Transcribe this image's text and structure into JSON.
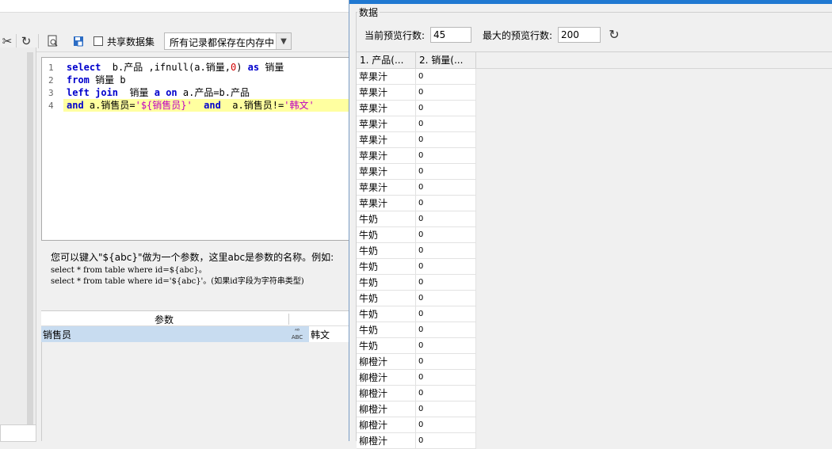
{
  "toolbar": {
    "share_label": "共享数据集",
    "memory_mode": "所有记录都保存在内存中"
  },
  "editor": {
    "line_numbers": [
      "1",
      "2",
      "3",
      "4"
    ],
    "line1": {
      "kw1": "select",
      "t1": "  b.产品 ,ifnull(a.销量,",
      "num": "0",
      "t2": ") ",
      "kw2": "as",
      "t3": " 销量"
    },
    "line2": {
      "kw1": "from",
      "t1": " 销量 b"
    },
    "line3": {
      "kw1": "left join",
      "t1": "  销量 ",
      "kw2": "a",
      "t2": " ",
      "kw3": "on",
      "t3": " a.产品=b.产品"
    },
    "line4": {
      "kw1": "and",
      "t1": " a.销售员=",
      "str1": "'${销售员}'",
      "t2": "  ",
      "kw2": "and",
      "t3": "  a.销售员!=",
      "str2": "'韩文'"
    }
  },
  "hint": {
    "line1": "您可以键入\"${abc}\"做为一个参数，这里abc是参数的名称。例如:",
    "line2": "select * from table where id=${abc}。",
    "line3": "select * from table where id='${abc}'。(如果id字段为字符串类型)"
  },
  "params": {
    "header": "参数",
    "rows": [
      {
        "name": "销售员",
        "type": "ABC",
        "value": "韩文"
      }
    ]
  },
  "dialog": {
    "group_title": "数据",
    "current_label": "当前预览行数:",
    "current_value": "45",
    "max_label": "最大的预览行数:",
    "max_value": "200",
    "refresh_icon": "refresh-icon",
    "columns": [
      "1. 产品(...",
      "2. 销量(..."
    ],
    "rows": [
      [
        "苹果汁",
        "0"
      ],
      [
        "苹果汁",
        "0"
      ],
      [
        "苹果汁",
        "0"
      ],
      [
        "苹果汁",
        "0"
      ],
      [
        "苹果汁",
        "0"
      ],
      [
        "苹果汁",
        "0"
      ],
      [
        "苹果汁",
        "0"
      ],
      [
        "苹果汁",
        "0"
      ],
      [
        "苹果汁",
        "0"
      ],
      [
        "牛奶",
        "0"
      ],
      [
        "牛奶",
        "0"
      ],
      [
        "牛奶",
        "0"
      ],
      [
        "牛奶",
        "0"
      ],
      [
        "牛奶",
        "0"
      ],
      [
        "牛奶",
        "0"
      ],
      [
        "牛奶",
        "0"
      ],
      [
        "牛奶",
        "0"
      ],
      [
        "牛奶",
        "0"
      ],
      [
        "柳橙汁",
        "0"
      ],
      [
        "柳橙汁",
        "0"
      ],
      [
        "柳橙汁",
        "0"
      ],
      [
        "柳橙汁",
        "0"
      ],
      [
        "柳橙汁",
        "0"
      ],
      [
        "柳橙汁",
        "0"
      ]
    ]
  }
}
